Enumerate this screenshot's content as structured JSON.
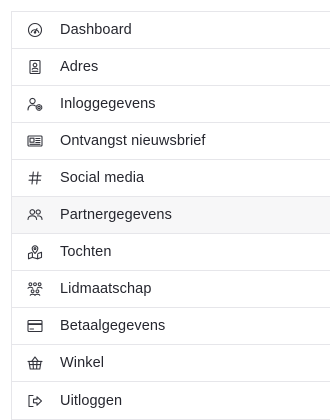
{
  "menu": {
    "items": [
      {
        "label": "Dashboard",
        "icon": "gauge-icon"
      },
      {
        "label": "Adres",
        "icon": "address-card-icon"
      },
      {
        "label": "Inloggegevens",
        "icon": "user-gear-icon"
      },
      {
        "label": "Ontvangst nieuwsbrief",
        "icon": "newspaper-icon"
      },
      {
        "label": "Social media",
        "icon": "hashtag-icon"
      },
      {
        "label": "Partnergegevens",
        "icon": "users-icon",
        "active": true
      },
      {
        "label": "Tochten",
        "icon": "map-pin-icon"
      },
      {
        "label": "Lidmaatschap",
        "icon": "group-icon"
      },
      {
        "label": "Betaalgegevens",
        "icon": "credit-card-icon"
      },
      {
        "label": "Winkel",
        "icon": "basket-icon"
      },
      {
        "label": "Uitloggen",
        "icon": "logout-icon"
      }
    ]
  },
  "colors": {
    "border": "#e6e6ea",
    "active_background": "#f7f7f8",
    "text": "#25262e"
  }
}
